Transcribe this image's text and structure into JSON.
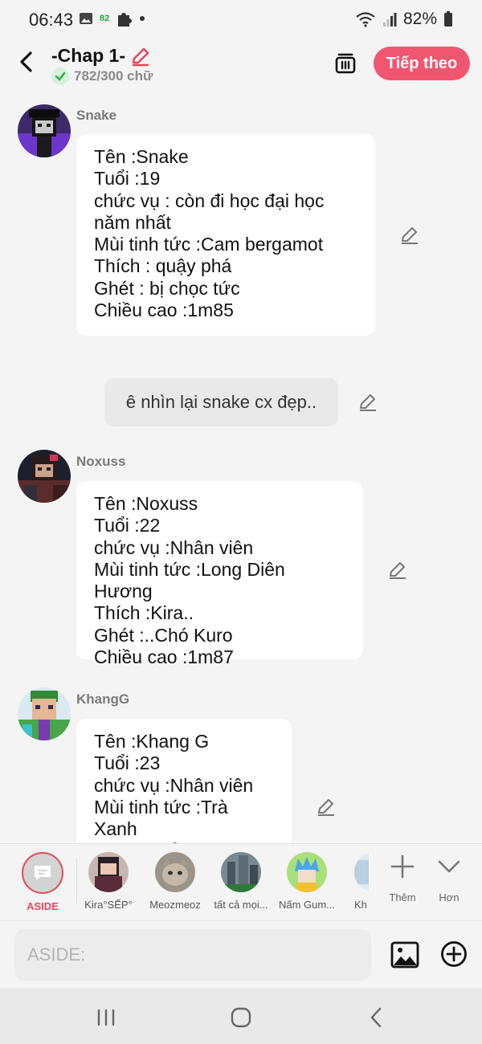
{
  "status_bar": {
    "time": "06:43",
    "badge": "82",
    "battery": "82%"
  },
  "header": {
    "chapter_title": "-Chap 1-",
    "word_count": "782/300 chữ",
    "next_button": "Tiếp theo"
  },
  "messages": [
    {
      "speaker": "Snake",
      "text": "Tên :Snake\nTuổi :19\nchức vụ : còn đi học đại học năm nhất\nMùi tinh tức :Cam bergamot\nThích : quậy phá\nGhét : bị chọc tức\nChiều cao :1m85"
    },
    {
      "aside": "ê nhìn lại snake cx đẹp.."
    },
    {
      "speaker": "Noxuss",
      "text": "Tên :Noxuss\nTuổi :22\nchức vụ :Nhân viên\nMùi tinh tức :Long Diên Hương\nThích :Kira..\nGhét :..Chó Kuro\nChiều cao :1m87"
    },
    {
      "speaker": "KhangG",
      "text": "Tên :Khang G\nTuổi :23\nchức vụ :Nhân viên\nMùi tinh tức :Trà Xanh\nThích :khủng long"
    }
  ],
  "character_bar": {
    "aside_label": "ASIDE",
    "characters": [
      "Kira°SẾP°",
      "Meozmeoz",
      "tất cả mọi...",
      "Nấm Gum...",
      "Kh"
    ],
    "add_label": "Thêm",
    "more_label": "Hơn"
  },
  "input": {
    "placeholder": "ASIDE:"
  },
  "colors": {
    "accent": "#f05670",
    "aside_red": "#e24a5c",
    "background": "#f4f4f4",
    "bubble": "#ffffff",
    "aside_bubble": "#e9e9e9"
  },
  "icons": {
    "back": "chevron-left-icon",
    "edit_title": "pencil-icon",
    "check": "check-icon",
    "delete": "trash-icon",
    "edit_message": "pencil-icon",
    "add": "plus-icon",
    "more": "chevron-down-icon",
    "image": "image-icon",
    "add_circle": "plus-circle-icon"
  }
}
